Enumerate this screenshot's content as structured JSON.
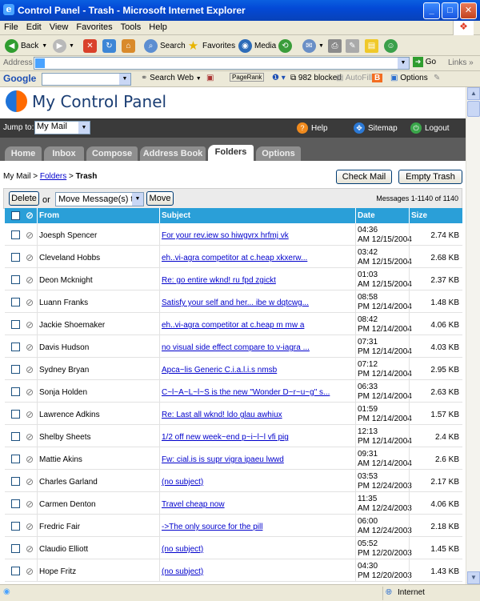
{
  "window": {
    "title": "Control Panel - Trash - Microsoft Internet Explorer"
  },
  "menu": [
    "File",
    "Edit",
    "View",
    "Favorites",
    "Tools",
    "Help"
  ],
  "toolbar": {
    "back": "Back",
    "search": "Search",
    "favorites": "Favorites",
    "media": "Media"
  },
  "address": {
    "label": "Address",
    "go": "Go",
    "links": "Links"
  },
  "google": {
    "label": "Google",
    "search_web": "Search Web",
    "pagerank": "PageRank",
    "blocked": "982 blocked",
    "autofill": "AutoFill",
    "options": "Options"
  },
  "app": {
    "title": "My Control Panel",
    "jump_label": "Jump to:",
    "jump_value": "My Mail",
    "help": "Help",
    "sitemap": "Sitemap",
    "logout": "Logout",
    "tabs": [
      "Home",
      "Inbox",
      "Compose",
      "Address Book",
      "Folders",
      "Options"
    ],
    "active_tab": "Folders",
    "breadcrumb": {
      "root": "My Mail",
      "sep1": " > ",
      "folders": "Folders",
      "sep2": " > ",
      "current": "Trash"
    },
    "check_mail": "Check Mail",
    "empty_trash": "Empty Trash",
    "delete": "Delete",
    "or": "or",
    "move_select": "Move Message(s) to:",
    "move": "Move",
    "message_count": "Messages 1-1140 of 1140",
    "columns": {
      "from": "From",
      "subject": "Subject",
      "date": "Date",
      "size": "Size"
    }
  },
  "messages": [
    {
      "from": "Joesph Spencer",
      "subject": "For your rev.iew so hiwgvrx hrfmj vk",
      "time": "04:36",
      "date": "AM 12/15/2004",
      "size": "2.74 KB"
    },
    {
      "from": "Cleveland Hobbs",
      "subject": "eh..vi-agra competitor at c.heap xkxerw...",
      "time": "03:42",
      "date": "AM 12/15/2004",
      "size": "2.68 KB"
    },
    {
      "from": "Deon Mcknight",
      "subject": "Re: go entire wknd! ru fpd zgickt",
      "time": "01:03",
      "date": "AM 12/15/2004",
      "size": "2.37 KB"
    },
    {
      "from": "Luann Franks",
      "subject": "Satisfy your self and her... ibe w dqtcwg...",
      "time": "08:58",
      "date": "PM 12/14/2004",
      "size": "1.48 KB"
    },
    {
      "from": "Jackie Shoemaker",
      "subject": "eh..vi-agra competitor at c.heap m mw a",
      "time": "08:42",
      "date": "PM 12/14/2004",
      "size": "4.06 KB"
    },
    {
      "from": "Davis Hudson",
      "subject": "no visual side effect compare to v-iagra ...",
      "time": "07:31",
      "date": "PM 12/14/2004",
      "size": "4.03 KB"
    },
    {
      "from": "Sydney Bryan",
      "subject": "Apca~lis Generic C.i.a.l.i.s nmsb",
      "time": "07:12",
      "date": "PM 12/14/2004",
      "size": "2.95 KB"
    },
    {
      "from": "Sonja Holden",
      "subject": "C~l~A~L~l~S is the new \"Wonder D~r~u~g\" s...",
      "time": "06:33",
      "date": "PM 12/14/2004",
      "size": "2.63 KB"
    },
    {
      "from": "Lawrence Adkins",
      "subject": "Re: Last all wknd! ldo glau awhiux",
      "time": "01:59",
      "date": "PM 12/14/2004",
      "size": "1.57 KB"
    },
    {
      "from": "Shelby Sheets",
      "subject": "1/2 off new week~end p~i~l~l vfi pig",
      "time": "12:13",
      "date": "PM 12/14/2004",
      "size": "2.4 KB"
    },
    {
      "from": "Mattie Akins",
      "subject": "Fw: cial.is is supr vigra ipaeu lwwd",
      "time": "09:31",
      "date": "AM 12/14/2004",
      "size": "2.6 KB"
    },
    {
      "from": "Charles Garland",
      "subject": "(no subject)",
      "time": "03:53",
      "date": "PM 12/24/2003",
      "size": "2.17 KB"
    },
    {
      "from": "Carmen Denton",
      "subject": "Travel cheap now",
      "time": "11:35",
      "date": "AM 12/24/2003",
      "size": "4.06 KB"
    },
    {
      "from": "Fredric Fair",
      "subject": "->The only source for the pill",
      "time": "06:00",
      "date": "AM 12/24/2003",
      "size": "2.18 KB"
    },
    {
      "from": "Claudio Elliott",
      "subject": "(no subject)",
      "time": "05:52",
      "date": "PM 12/20/2003",
      "size": "1.45 KB"
    },
    {
      "from": "Hope Fritz",
      "subject": "(no subject)",
      "time": "04:30",
      "date": "PM 12/20/2003",
      "size": "1.43 KB"
    }
  ],
  "status": {
    "zone": "Internet"
  }
}
